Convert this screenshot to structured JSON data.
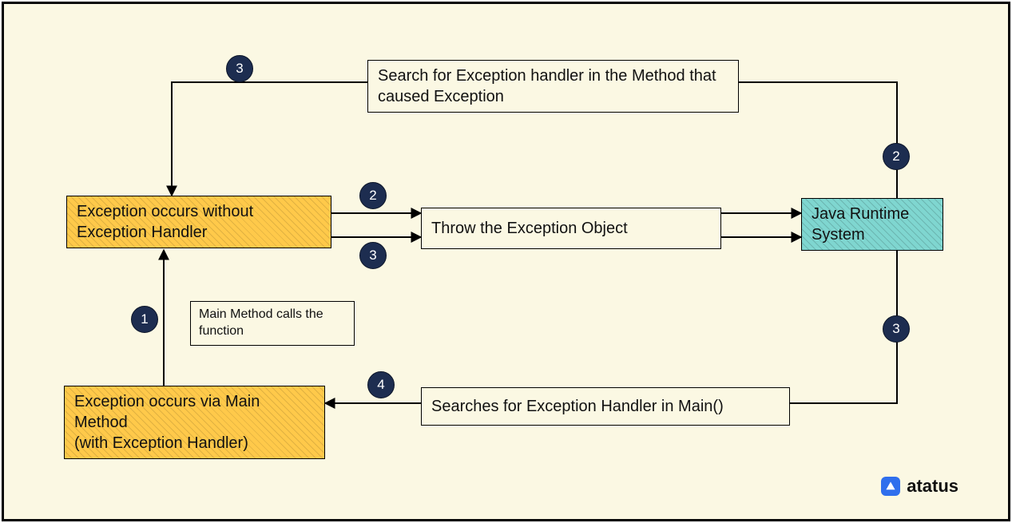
{
  "boxes": {
    "ex_without_handler": "Exception occurs without Exception Handler",
    "ex_via_main": "Exception occurs via Main Method\n(with Exception Handler)",
    "throw_object": "Throw the Exception Object",
    "java_runtime": "Java Runtime System",
    "search_method": "Search for Exception handler in the Method that caused Exception",
    "search_main": "Searches for Exception Handler in Main()",
    "main_calls_note": "Main Method calls the function"
  },
  "badges": {
    "top_left_3": "3",
    "right_2": "2",
    "mid_2": "2",
    "mid_3": "3",
    "left_1": "1",
    "right_3": "3",
    "bottom_4": "4"
  },
  "brand": {
    "name": "atatus"
  }
}
